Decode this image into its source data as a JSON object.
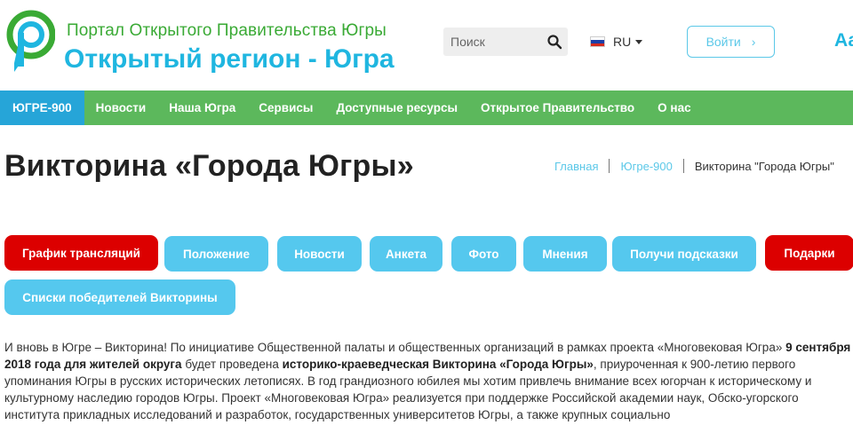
{
  "header": {
    "site_subtitle": "Портал Открытого Правительства Югры",
    "site_title": "Открытый регион - Югра",
    "search_placeholder": "Поиск",
    "language": "RU",
    "login_label": "Войти",
    "font_size_label": "Аа",
    "brand_green": "#3aaa35",
    "brand_blue": "#1fb6e0"
  },
  "nav": {
    "items": [
      {
        "label": "ЮГРЕ-900",
        "active": true
      },
      {
        "label": "Новости"
      },
      {
        "label": "Наша Югра"
      },
      {
        "label": "Сервисы"
      },
      {
        "label": "Доступные ресурсы"
      },
      {
        "label": "Открытое Правительство"
      },
      {
        "label": "О нас"
      }
    ],
    "color": "#5cb85c",
    "active_color": "#26a5d8"
  },
  "page": {
    "title": "Викторина «Города Югры»",
    "breadcrumb": [
      "Главная",
      "Югре-900",
      "Викторина \"Города Югры\""
    ]
  },
  "buttons": [
    {
      "label": "График трансляций",
      "color": "red"
    },
    {
      "label": "Положение",
      "color": "blue"
    },
    {
      "label": "Новости",
      "color": "blue"
    },
    {
      "label": "Анкета",
      "color": "blue"
    },
    {
      "label": "Фото",
      "color": "blue"
    },
    {
      "label": "Мнения",
      "color": "blue"
    },
    {
      "label": "Получи подсказки",
      "color": "blue"
    },
    {
      "label": "Подарки",
      "color": "red"
    },
    {
      "label": "Списки победителей Викторины",
      "color": "blue"
    }
  ],
  "article": {
    "p1_a": "И вновь в Югре – Викторина! По инициативе Общественной палаты и общественных организаций в рамках проекта «Многовековая Югра» ",
    "p1_b": "9 сентября 2018 года для жителей округа",
    "p1_c": " будет проведена ",
    "p1_d": "историко-краеведческая Викторина «Города Югры»",
    "p1_e": ", приуроченная к 900-летию первого упоминания Югры в русских исторических летописях.  В год грандиозного юбилея мы хотим привлечь внимание всех югорчан к историческому и культурному наследию городов Югры. Проект «Многовековая Югра» реализуется при поддержке Российской академии наук, Обско-угорского института прикладных исследований и разработок, государственных университетов Югры, а также крупных социально"
  }
}
